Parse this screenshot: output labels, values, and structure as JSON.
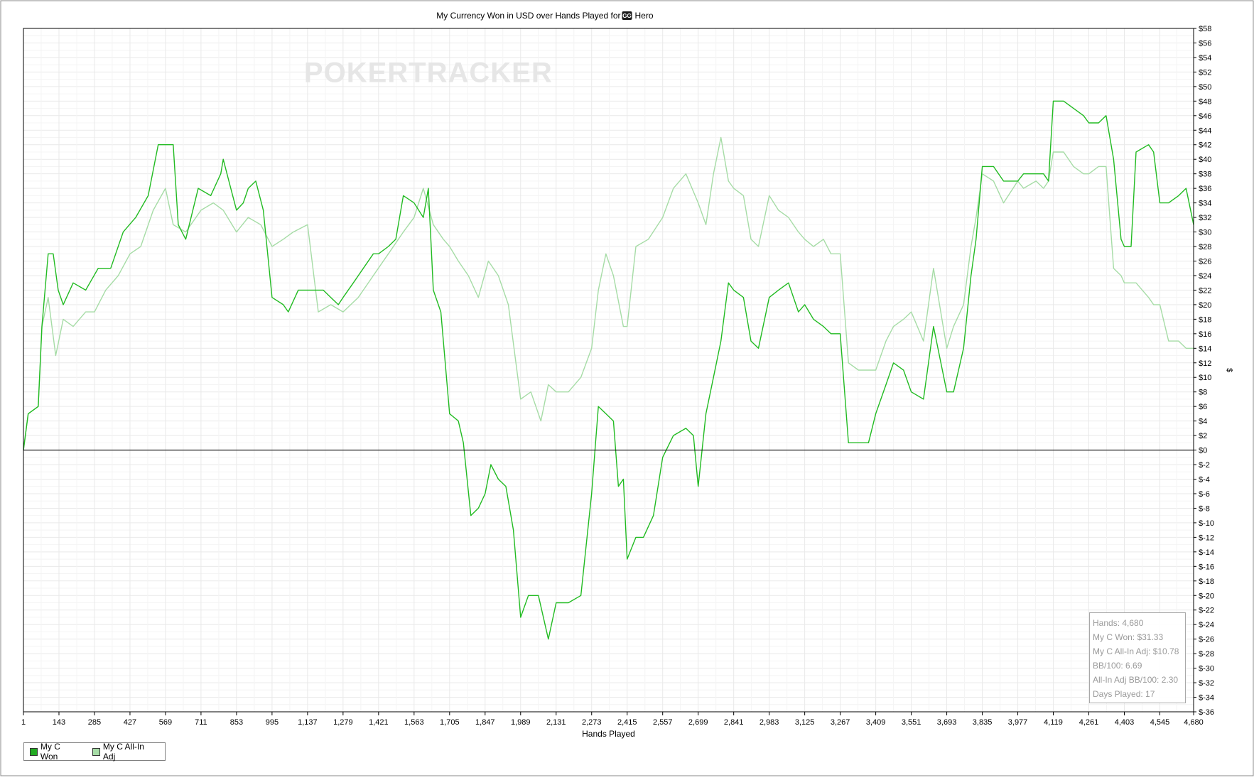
{
  "chart_data": {
    "type": "line",
    "title": "My Currency Won in USD over Hands Played for",
    "title_player": "Hero",
    "title_badge": "GG",
    "watermark": "POKERTRACKER",
    "xlabel": "Hands Played",
    "ylabel": "$",
    "xlim": [
      1,
      4680
    ],
    "ylim": [
      -36,
      58
    ],
    "x_ticks": [
      1,
      143,
      285,
      427,
      569,
      711,
      853,
      995,
      1137,
      1279,
      1421,
      1563,
      1705,
      1847,
      1989,
      2131,
      2273,
      2415,
      2557,
      2699,
      2841,
      2983,
      3125,
      3267,
      3409,
      3551,
      3693,
      3835,
      3977,
      4119,
      4261,
      4403,
      4545,
      4680
    ],
    "y_ticks": [
      58,
      56,
      54,
      52,
      50,
      48,
      46,
      44,
      42,
      40,
      38,
      36,
      34,
      32,
      30,
      28,
      26,
      24,
      22,
      20,
      18,
      16,
      14,
      12,
      10,
      8,
      6,
      4,
      2,
      0,
      -2,
      -4,
      -6,
      -8,
      -10,
      -12,
      -14,
      -16,
      -18,
      -20,
      -22,
      -24,
      -26,
      -28,
      -30,
      -32,
      -34,
      -36
    ],
    "grid": true,
    "legend_position": "bottom-left",
    "series": [
      {
        "name": "My C Won",
        "color": "#22bb22",
        "points": [
          [
            1,
            0
          ],
          [
            20,
            5
          ],
          [
            60,
            6
          ],
          [
            75,
            17
          ],
          [
            100,
            27
          ],
          [
            120,
            27
          ],
          [
            140,
            22
          ],
          [
            160,
            20
          ],
          [
            200,
            23
          ],
          [
            250,
            22
          ],
          [
            300,
            25
          ],
          [
            350,
            25
          ],
          [
            400,
            30
          ],
          [
            450,
            32
          ],
          [
            500,
            35
          ],
          [
            540,
            42
          ],
          [
            569,
            42
          ],
          [
            600,
            42
          ],
          [
            620,
            31
          ],
          [
            650,
            29
          ],
          [
            700,
            36
          ],
          [
            750,
            35
          ],
          [
            790,
            38
          ],
          [
            800,
            40
          ],
          [
            830,
            36
          ],
          [
            853,
            33
          ],
          [
            880,
            34
          ],
          [
            900,
            36
          ],
          [
            930,
            37
          ],
          [
            960,
            33
          ],
          [
            995,
            21
          ],
          [
            1040,
            20
          ],
          [
            1060,
            19
          ],
          [
            1100,
            22
          ],
          [
            1137,
            22
          ],
          [
            1200,
            22
          ],
          [
            1230,
            21
          ],
          [
            1260,
            20
          ],
          [
            1279,
            21
          ],
          [
            1320,
            23
          ],
          [
            1360,
            25
          ],
          [
            1400,
            27
          ],
          [
            1421,
            27
          ],
          [
            1460,
            28
          ],
          [
            1490,
            29
          ],
          [
            1520,
            35
          ],
          [
            1563,
            34
          ],
          [
            1600,
            32
          ],
          [
            1620,
            36
          ],
          [
            1640,
            22
          ],
          [
            1670,
            19
          ],
          [
            1705,
            5
          ],
          [
            1740,
            4
          ],
          [
            1760,
            1
          ],
          [
            1790,
            -9
          ],
          [
            1820,
            -8
          ],
          [
            1847,
            -6
          ],
          [
            1870,
            -2
          ],
          [
            1900,
            -4
          ],
          [
            1930,
            -5
          ],
          [
            1960,
            -11
          ],
          [
            1989,
            -23
          ],
          [
            2020,
            -20
          ],
          [
            2060,
            -20
          ],
          [
            2100,
            -26
          ],
          [
            2131,
            -21
          ],
          [
            2180,
            -21
          ],
          [
            2230,
            -20
          ],
          [
            2273,
            -6
          ],
          [
            2300,
            6
          ],
          [
            2330,
            5
          ],
          [
            2360,
            4
          ],
          [
            2380,
            -5
          ],
          [
            2400,
            -4
          ],
          [
            2415,
            -15
          ],
          [
            2450,
            -12
          ],
          [
            2480,
            -12
          ],
          [
            2520,
            -9
          ],
          [
            2557,
            -1
          ],
          [
            2600,
            2
          ],
          [
            2650,
            3
          ],
          [
            2680,
            2
          ],
          [
            2699,
            -5
          ],
          [
            2730,
            5
          ],
          [
            2760,
            10
          ],
          [
            2790,
            15
          ],
          [
            2820,
            23
          ],
          [
            2841,
            22
          ],
          [
            2880,
            21
          ],
          [
            2910,
            15
          ],
          [
            2940,
            14
          ],
          [
            2983,
            21
          ],
          [
            3020,
            22
          ],
          [
            3060,
            23
          ],
          [
            3100,
            19
          ],
          [
            3125,
            20
          ],
          [
            3160,
            18
          ],
          [
            3200,
            17
          ],
          [
            3230,
            16
          ],
          [
            3267,
            16
          ],
          [
            3300,
            1
          ],
          [
            3340,
            1
          ],
          [
            3380,
            1
          ],
          [
            3409,
            5
          ],
          [
            3450,
            9
          ],
          [
            3480,
            12
          ],
          [
            3520,
            11
          ],
          [
            3551,
            8
          ],
          [
            3600,
            7
          ],
          [
            3640,
            17
          ],
          [
            3693,
            8
          ],
          [
            3720,
            8
          ],
          [
            3760,
            14
          ],
          [
            3790,
            24
          ],
          [
            3810,
            29
          ],
          [
            3835,
            39
          ],
          [
            3880,
            39
          ],
          [
            3920,
            37
          ],
          [
            3977,
            37
          ],
          [
            4000,
            38
          ],
          [
            4050,
            38
          ],
          [
            4080,
            38
          ],
          [
            4100,
            37
          ],
          [
            4119,
            48
          ],
          [
            4160,
            48
          ],
          [
            4200,
            47
          ],
          [
            4240,
            46
          ],
          [
            4261,
            45
          ],
          [
            4300,
            45
          ],
          [
            4330,
            46
          ],
          [
            4360,
            40
          ],
          [
            4390,
            29
          ],
          [
            4403,
            28
          ],
          [
            4430,
            28
          ],
          [
            4450,
            41
          ],
          [
            4500,
            42
          ],
          [
            4520,
            41
          ],
          [
            4545,
            34
          ],
          [
            4580,
            34
          ],
          [
            4620,
            35
          ],
          [
            4650,
            36
          ],
          [
            4680,
            31
          ]
        ]
      },
      {
        "name": "My C All-In Adj",
        "color": "#a6dca6",
        "points": [
          [
            1,
            0
          ],
          [
            20,
            5
          ],
          [
            60,
            6
          ],
          [
            75,
            17
          ],
          [
            100,
            21
          ],
          [
            130,
            13
          ],
          [
            160,
            18
          ],
          [
            200,
            17
          ],
          [
            250,
            19
          ],
          [
            285,
            19
          ],
          [
            330,
            22
          ],
          [
            380,
            24
          ],
          [
            427,
            27
          ],
          [
            470,
            28
          ],
          [
            520,
            33
          ],
          [
            569,
            36
          ],
          [
            600,
            31
          ],
          [
            650,
            30
          ],
          [
            711,
            33
          ],
          [
            760,
            34
          ],
          [
            800,
            33
          ],
          [
            853,
            30
          ],
          [
            900,
            32
          ],
          [
            950,
            31
          ],
          [
            995,
            28
          ],
          [
            1040,
            29
          ],
          [
            1080,
            30
          ],
          [
            1137,
            31
          ],
          [
            1180,
            19
          ],
          [
            1230,
            20
          ],
          [
            1279,
            19
          ],
          [
            1340,
            21
          ],
          [
            1400,
            24
          ],
          [
            1460,
            27
          ],
          [
            1520,
            30
          ],
          [
            1563,
            32
          ],
          [
            1600,
            36
          ],
          [
            1640,
            31
          ],
          [
            1680,
            29
          ],
          [
            1705,
            28
          ],
          [
            1740,
            26
          ],
          [
            1780,
            24
          ],
          [
            1820,
            21
          ],
          [
            1860,
            26
          ],
          [
            1900,
            24
          ],
          [
            1940,
            20
          ],
          [
            1989,
            7
          ],
          [
            2030,
            8
          ],
          [
            2070,
            4
          ],
          [
            2100,
            9
          ],
          [
            2131,
            8
          ],
          [
            2180,
            8
          ],
          [
            2230,
            10
          ],
          [
            2273,
            14
          ],
          [
            2300,
            22
          ],
          [
            2330,
            27
          ],
          [
            2360,
            24
          ],
          [
            2400,
            17
          ],
          [
            2415,
            17
          ],
          [
            2450,
            28
          ],
          [
            2500,
            29
          ],
          [
            2557,
            32
          ],
          [
            2600,
            36
          ],
          [
            2650,
            38
          ],
          [
            2699,
            34
          ],
          [
            2730,
            31
          ],
          [
            2760,
            38
          ],
          [
            2790,
            43
          ],
          [
            2820,
            37
          ],
          [
            2841,
            36
          ],
          [
            2880,
            35
          ],
          [
            2910,
            29
          ],
          [
            2940,
            28
          ],
          [
            2983,
            35
          ],
          [
            3020,
            33
          ],
          [
            3060,
            32
          ],
          [
            3100,
            30
          ],
          [
            3125,
            29
          ],
          [
            3160,
            28
          ],
          [
            3200,
            29
          ],
          [
            3230,
            27
          ],
          [
            3267,
            27
          ],
          [
            3300,
            12
          ],
          [
            3340,
            11
          ],
          [
            3380,
            11
          ],
          [
            3409,
            11
          ],
          [
            3450,
            15
          ],
          [
            3480,
            17
          ],
          [
            3520,
            18
          ],
          [
            3551,
            19
          ],
          [
            3600,
            15
          ],
          [
            3640,
            25
          ],
          [
            3693,
            14
          ],
          [
            3720,
            17
          ],
          [
            3760,
            20
          ],
          [
            3790,
            28
          ],
          [
            3810,
            32
          ],
          [
            3835,
            38
          ],
          [
            3880,
            37
          ],
          [
            3920,
            34
          ],
          [
            3977,
            37
          ],
          [
            4000,
            36
          ],
          [
            4050,
            37
          ],
          [
            4080,
            36
          ],
          [
            4100,
            37
          ],
          [
            4119,
            41
          ],
          [
            4160,
            41
          ],
          [
            4200,
            39
          ],
          [
            4240,
            38
          ],
          [
            4261,
            38
          ],
          [
            4300,
            39
          ],
          [
            4330,
            39
          ],
          [
            4360,
            25
          ],
          [
            4390,
            24
          ],
          [
            4403,
            23
          ],
          [
            4430,
            23
          ],
          [
            4450,
            23
          ],
          [
            4500,
            21
          ],
          [
            4520,
            20
          ],
          [
            4545,
            20
          ],
          [
            4580,
            15
          ],
          [
            4620,
            15
          ],
          [
            4650,
            14
          ],
          [
            4680,
            14
          ]
        ]
      }
    ]
  },
  "stats": {
    "hands": "Hands: 4,680",
    "won": "My C Won: $31.33",
    "all_in_adj": "My C All-In Adj: $10.78",
    "bb100": "BB/100: 6.69",
    "all_in_bb100": "All-In Adj BB/100: 2.30",
    "days": "Days Played: 17"
  },
  "legend": {
    "won_label": "My C Won",
    "won_color": "#22aa22",
    "adj_label": "My C All-In Adj",
    "adj_color": "#a6dca6"
  }
}
